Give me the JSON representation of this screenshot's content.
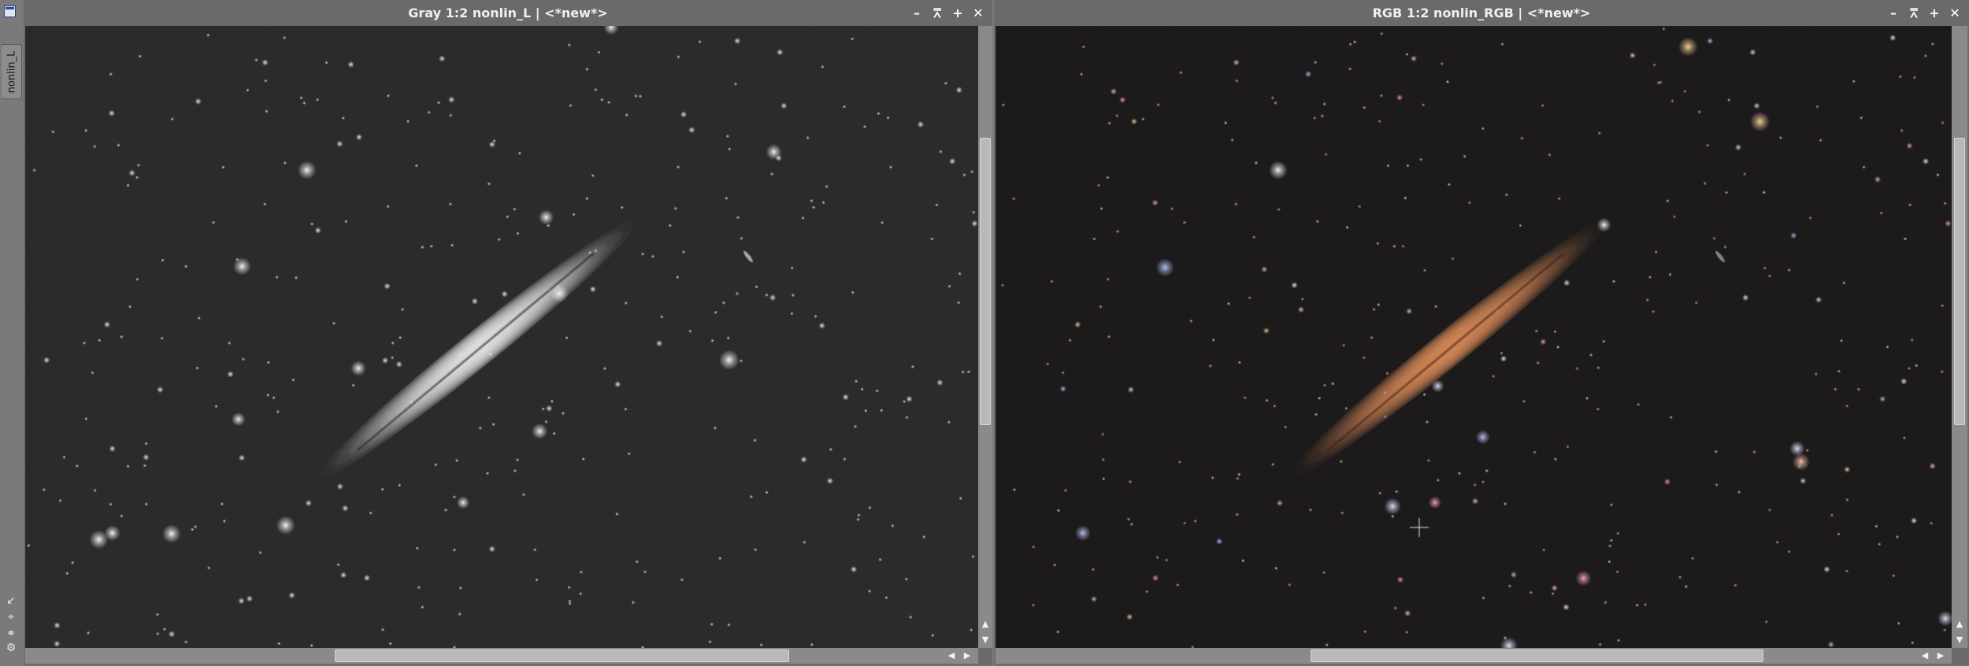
{
  "side_strip": {
    "tab_label": "nonlin_L",
    "icons": [
      "window-icon",
      "shrink-icon",
      "explode-icon",
      "link-icon",
      "settings-icon"
    ]
  },
  "windows": [
    {
      "id": "left",
      "title": "Gray 1:2 nonlin_L | <*new*>",
      "mode": "gray",
      "buttons": {
        "minimize": "–",
        "shade": "⩞",
        "maximize": "+",
        "close": "✕"
      }
    },
    {
      "id": "right",
      "title": "RGB 1:2 nonlin_RGB | <*new*>",
      "mode": "rgb",
      "buttons": {
        "minimize": "–",
        "shade": "⩞",
        "maximize": "+",
        "close": "✕"
      }
    }
  ],
  "scroll_arrows": {
    "up": "▲",
    "down": "▼",
    "left": "◀",
    "right": "▶"
  },
  "colors": {
    "gray_sky": "#2b2b2b",
    "rgb_sky": "#1c1a1b",
    "galaxy_gray": "#e8e8e8",
    "galaxy_rgb": "#d98a58",
    "chrome": "#6a6a6a"
  }
}
